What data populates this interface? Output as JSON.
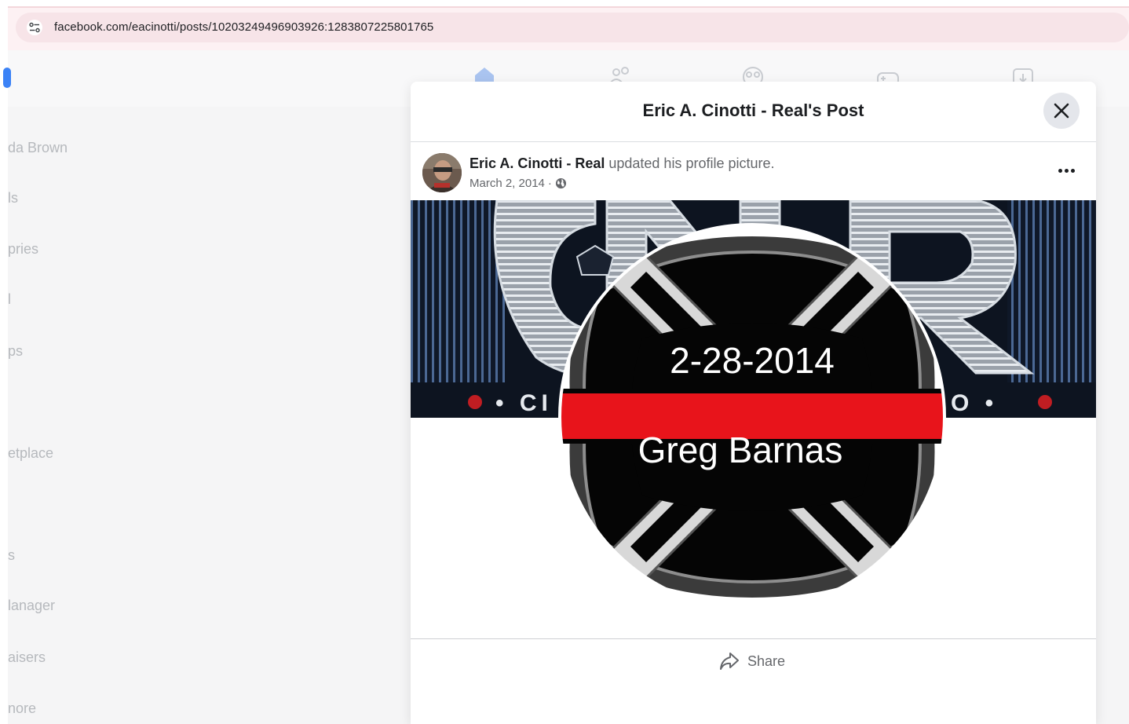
{
  "browser": {
    "url": "facebook.com/eacinotti/posts/10203249496903926:1283807225801765"
  },
  "sidebar": {
    "items": [
      {
        "label": "da Brown"
      },
      {
        "label": "ls"
      },
      {
        "label": "pries"
      },
      {
        "label": "l"
      },
      {
        "label": "ps"
      },
      {
        "label": "etplace"
      },
      {
        "label": "s"
      },
      {
        "label": "lanager"
      },
      {
        "label": "aisers"
      },
      {
        "label": "nore"
      }
    ]
  },
  "modal": {
    "title": "Eric A. Cinotti - Real's Post",
    "post": {
      "author": "Eric A. Cinotti - Real",
      "action": " updated his profile picture.",
      "date": "March 2, 2014",
      "separator": "·",
      "image": {
        "cover_text_left": "• CI",
        "cover_text_right": "O •",
        "badge_date": "2-28-2014",
        "badge_name": "Greg Barnas"
      }
    },
    "actions": {
      "share_label": "Share"
    }
  },
  "colors": {
    "accent_red": "#e8141b",
    "badge_black": "#050505",
    "icon_blue": "#3b82f6"
  }
}
